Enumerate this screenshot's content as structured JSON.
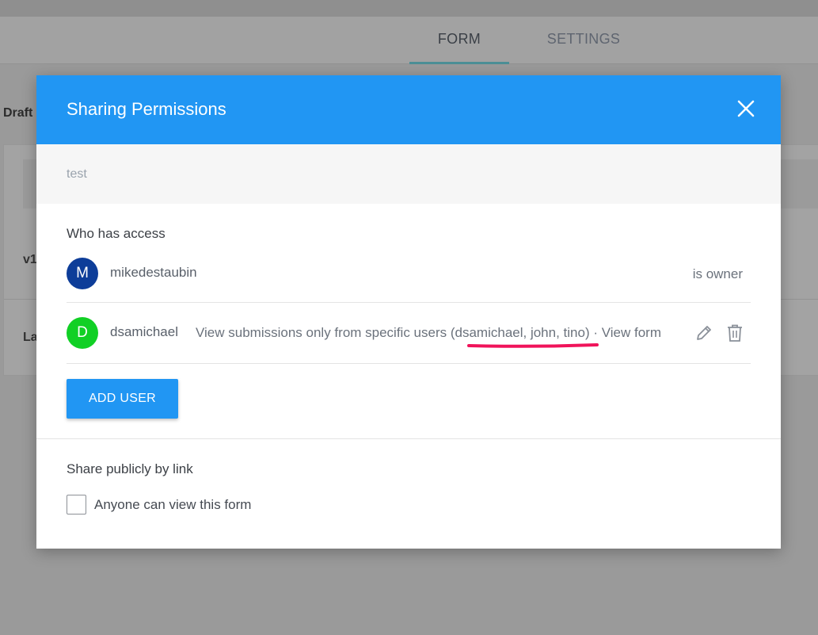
{
  "tabs": [
    {
      "label": "FORM",
      "active": true
    },
    {
      "label": "SETTINGS",
      "active": false
    }
  ],
  "background": {
    "draft_label": "Draft",
    "row_labels": [
      "v1",
      "La"
    ]
  },
  "modal": {
    "title": "Sharing Permissions",
    "close_icon": "close-icon",
    "form_name": "test",
    "who_has_access_title": "Who has access",
    "users": [
      {
        "initial": "M",
        "name": "mikedestaubin",
        "role": "is owner",
        "avatar_color": "#0d3d99"
      },
      {
        "initial": "D",
        "name": "dsamichael",
        "permission": "View submissions only from specific users (dsamichael, john, tino) · View form",
        "avatar_color": "#11d025",
        "actions": [
          "edit-icon",
          "trash-icon"
        ]
      }
    ],
    "add_user_label": "ADD USER",
    "share_public_title": "Share publicly by link",
    "public_checkbox_label": "Anyone can view this form",
    "public_checkbox_checked": false
  },
  "colors": {
    "accent": "#2196f3",
    "annotation_underline": "#f0135a"
  }
}
